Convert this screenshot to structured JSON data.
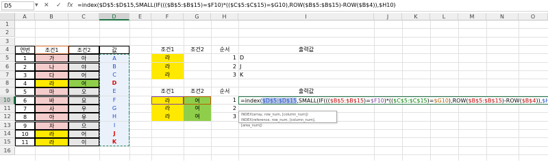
{
  "formula_bar": {
    "name_box": "D5",
    "cancel_icon": "✕",
    "enter_icon": "✓",
    "fx_label": "fx",
    "formula": "=index($D$5:$D$15,SMALL(IF((($B$5:$B$15)=$F10)*(($C$5:$C$15)=$G10),ROW($B$5:$B$15)-ROW($B$4)),$H10)"
  },
  "columns": [
    "A",
    "B",
    "C",
    "D",
    "E",
    "F",
    "G",
    "H",
    "I",
    "J",
    "K",
    "L",
    "M",
    "N",
    "O"
  ],
  "rows": [
    "1",
    "2",
    "3",
    "4",
    "5",
    "6",
    "7",
    "8",
    "9",
    "10",
    "11",
    "12",
    "13",
    "14",
    "15",
    "16"
  ],
  "table": {
    "headers": [
      "연번",
      "조건1",
      "조건2",
      "값"
    ],
    "rows": [
      [
        "1",
        "가",
        "아",
        "A"
      ],
      [
        "2",
        "나",
        "야",
        "B"
      ],
      [
        "3",
        "다",
        "어",
        "C"
      ],
      [
        "4",
        "라",
        "여",
        "D"
      ],
      [
        "5",
        "마",
        "오",
        "E"
      ],
      [
        "6",
        "바",
        "요",
        "F"
      ],
      [
        "7",
        "사",
        "우",
        "G"
      ],
      [
        "8",
        "아",
        "유",
        "H"
      ],
      [
        "9",
        "자",
        "으",
        "I"
      ],
      [
        "10",
        "라",
        "어",
        "J"
      ],
      [
        "11",
        "라",
        "이",
        "K"
      ]
    ]
  },
  "lookup1": {
    "headers": [
      "조건1",
      "조건2",
      "순서",
      "출력값"
    ],
    "rows": [
      [
        "라",
        "",
        "1",
        "D"
      ],
      [
        "라",
        "",
        "2",
        "J"
      ],
      [
        "라",
        "",
        "3",
        "K"
      ]
    ]
  },
  "lookup2": {
    "headers": [
      "조건1",
      "조건2",
      "순서",
      "출력값"
    ],
    "rows": [
      [
        "라",
        "여",
        "1",
        ""
      ],
      [
        "라",
        "여",
        "2",
        ""
      ],
      [
        "라",
        "여",
        "3",
        ""
      ]
    ],
    "edit_formula": {
      "p1": "=index(",
      "p2": "$D$5:$D$15",
      "p3": ",SMALL(IF(((",
      "p4": "$B$5:$B$15",
      "p5": ")=",
      "p6": "$F10",
      "p7": ")*((",
      "p8": "$C$5:$C$15",
      "p9": ")=",
      "p10": "$G10",
      "p11": "),ROW(",
      "p12": "$B$5:$B$15",
      "p13": ")-ROW(",
      "p14": "$B$4",
      "p15": ")),",
      "p16": "$H10",
      "p17": ")"
    }
  },
  "tooltip": {
    "line1": "INDEX(array, row_num, [column_num])",
    "line2": "INDEX(reference, row_num, [column_num], [area_num])"
  },
  "colors": {
    "pink": "#f4cccc",
    "gray": "#e7e6e6",
    "yellow": "#ffe900",
    "green": "#8fce4b",
    "excel_green": "#217346",
    "red_text": "#e00000"
  }
}
